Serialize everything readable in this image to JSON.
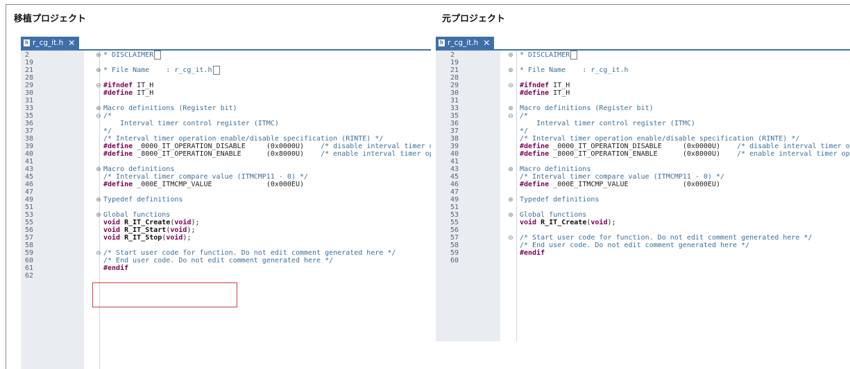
{
  "captions": {
    "left": "移植プロジェクト",
    "right": "元プロジェクト"
  },
  "tabs": {
    "left": "r_cg_it.h",
    "right": "r_cg_it.h"
  },
  "file_icon_glyph": "h",
  "close_glyph": "✕",
  "fold_glyphs": {
    "expand": "⊕",
    "collapse": "⊖"
  },
  "colors": {
    "tab": "#3e6fa8",
    "comment": "#3a6f9a",
    "keyword": "#7b0052",
    "highlight": "#d23a3a"
  },
  "left_lines": [
    {
      "ln": "2",
      "fold": "expand",
      "segs": [
        {
          "c": "cmt",
          "t": "* DISCLAIMER"
        },
        {
          "c": "box",
          "t": " "
        }
      ]
    },
    {
      "ln": "19"
    },
    {
      "ln": "21",
      "fold": "expand",
      "segs": [
        {
          "c": "cmt",
          "t": "* File Name    : r_cg_it.h"
        },
        {
          "c": "box",
          "t": " "
        }
      ]
    },
    {
      "ln": "28"
    },
    {
      "ln": "29",
      "fold": "collapse",
      "segs": [
        {
          "c": "kw",
          "t": "#ifndef"
        },
        {
          "c": "",
          "t": " IT_H"
        }
      ]
    },
    {
      "ln": "30",
      "segs": [
        {
          "c": "kw",
          "t": "#define"
        },
        {
          "c": "",
          "t": " IT_H"
        }
      ]
    },
    {
      "ln": "31"
    },
    {
      "ln": "33",
      "fold": "expand",
      "segs": [
        {
          "c": "cmt",
          "t": "Macro definitions (Register bit)"
        }
      ]
    },
    {
      "ln": "35",
      "fold": "collapse",
      "segs": [
        {
          "c": "cmt",
          "t": "/*"
        }
      ]
    },
    {
      "ln": "36",
      "segs": [
        {
          "c": "cmt",
          "t": "    Interval timer control register (ITMC)"
        }
      ]
    },
    {
      "ln": "37",
      "segs": [
        {
          "c": "cmt",
          "t": "*/"
        }
      ]
    },
    {
      "ln": "38",
      "segs": [
        {
          "c": "cmt",
          "t": "/* Interval timer operation enable/disable specification (RINTE) */"
        }
      ]
    },
    {
      "ln": "39",
      "segs": [
        {
          "c": "kw",
          "t": "#define"
        },
        {
          "c": "",
          "t": " _0000_IT_OPERATION_DISABLE     (0x0000U)    "
        },
        {
          "c": "cmt",
          "t": "/* disable interval timer operation */"
        }
      ]
    },
    {
      "ln": "40",
      "segs": [
        {
          "c": "kw",
          "t": "#define"
        },
        {
          "c": "",
          "t": " _8000_IT_OPERATION_ENABLE      (0x8000U)    "
        },
        {
          "c": "cmt",
          "t": "/* enable interval timer operation */"
        }
      ]
    },
    {
      "ln": "41"
    },
    {
      "ln": "43",
      "fold": "expand",
      "segs": [
        {
          "c": "cmt",
          "t": "Macro definitions"
        }
      ]
    },
    {
      "ln": "45",
      "segs": [
        {
          "c": "cmt",
          "t": "/* Interval timer compare value (ITMCMP11 - 0) */"
        }
      ]
    },
    {
      "ln": "46",
      "segs": [
        {
          "c": "kw",
          "t": "#define"
        },
        {
          "c": "",
          "t": " _000E_ITMCMP_VALUE             (0x000EU)"
        }
      ]
    },
    {
      "ln": "47"
    },
    {
      "ln": "49",
      "fold": "expand",
      "segs": [
        {
          "c": "cmt",
          "t": "Typedef definitions"
        }
      ]
    },
    {
      "ln": "51"
    },
    {
      "ln": "53",
      "fold": "expand",
      "segs": [
        {
          "c": "cmt",
          "t": "Global functions"
        }
      ]
    },
    {
      "ln": "55",
      "segs": [
        {
          "c": "kw",
          "t": "void"
        },
        {
          "c": "",
          "t": " "
        },
        {
          "c": "ident",
          "t": "R_IT_Create"
        },
        {
          "c": "",
          "t": "("
        },
        {
          "c": "kw",
          "t": "void"
        },
        {
          "c": "",
          "t": ");"
        }
      ]
    },
    {
      "ln": "56",
      "segs": [
        {
          "c": "kw",
          "t": "void"
        },
        {
          "c": "",
          "t": " "
        },
        {
          "c": "ident",
          "t": "R_IT_Start"
        },
        {
          "c": "",
          "t": "("
        },
        {
          "c": "kw",
          "t": "void"
        },
        {
          "c": "",
          "t": ");"
        }
      ]
    },
    {
      "ln": "57",
      "segs": [
        {
          "c": "kw",
          "t": "void"
        },
        {
          "c": "",
          "t": " "
        },
        {
          "c": "ident",
          "t": "R_IT_Stop"
        },
        {
          "c": "",
          "t": "("
        },
        {
          "c": "kw",
          "t": "void"
        },
        {
          "c": "",
          "t": ");"
        }
      ]
    },
    {
      "ln": "58"
    },
    {
      "ln": "59",
      "fold": "collapse",
      "segs": [
        {
          "c": "cmt",
          "t": "/* Start user code for function. Do not edit comment generated here */"
        }
      ]
    },
    {
      "ln": "60",
      "segs": [
        {
          "c": "cmt",
          "t": "/* End user code. Do not edit comment generated here */"
        }
      ]
    },
    {
      "ln": "61",
      "segs": [
        {
          "c": "kw",
          "t": "#endif"
        }
      ]
    },
    {
      "ln": "62"
    }
  ],
  "right_lines": [
    {
      "ln": "2",
      "fold": "expand",
      "segs": [
        {
          "c": "cmt",
          "t": "* DISCLAIMER"
        },
        {
          "c": "box",
          "t": " "
        }
      ]
    },
    {
      "ln": "19"
    },
    {
      "ln": "21",
      "fold": "expand",
      "segs": [
        {
          "c": "cmt",
          "t": "* File Name    : r_cg_it.h"
        }
      ]
    },
    {
      "ln": "28"
    },
    {
      "ln": "29",
      "fold": "collapse",
      "segs": [
        {
          "c": "kw",
          "t": "#ifndef"
        },
        {
          "c": "",
          "t": " IT_H"
        }
      ]
    },
    {
      "ln": "30",
      "segs": [
        {
          "c": "kw",
          "t": "#define"
        },
        {
          "c": "",
          "t": " IT_H"
        }
      ]
    },
    {
      "ln": "31"
    },
    {
      "ln": "33",
      "fold": "expand",
      "segs": [
        {
          "c": "cmt",
          "t": "Macro definitions (Register bit)"
        }
      ]
    },
    {
      "ln": "35",
      "fold": "collapse",
      "segs": [
        {
          "c": "cmt",
          "t": "/*"
        }
      ]
    },
    {
      "ln": "36",
      "segs": [
        {
          "c": "cmt",
          "t": "    Interval timer control register (ITMC)"
        }
      ]
    },
    {
      "ln": "37",
      "segs": [
        {
          "c": "cmt",
          "t": "*/"
        }
      ]
    },
    {
      "ln": "38",
      "segs": [
        {
          "c": "cmt",
          "t": "/* Interval timer operation enable/disable specification (RINTE) */"
        }
      ]
    },
    {
      "ln": "39",
      "segs": [
        {
          "c": "kw",
          "t": "#define"
        },
        {
          "c": "",
          "t": " _0000_IT_OPERATION_DISABLE     (0x0000U)    "
        },
        {
          "c": "cmt",
          "t": "/* disable interval timer operation */"
        }
      ]
    },
    {
      "ln": "40",
      "segs": [
        {
          "c": "kw",
          "t": "#define"
        },
        {
          "c": "",
          "t": " _8000_IT_OPERATION_ENABLE      (0x8000U)    "
        },
        {
          "c": "cmt",
          "t": "/* enable interval timer operation */"
        }
      ]
    },
    {
      "ln": "41"
    },
    {
      "ln": "43",
      "fold": "expand",
      "segs": [
        {
          "c": "cmt",
          "t": "Macro definitions"
        }
      ]
    },
    {
      "ln": "45",
      "segs": [
        {
          "c": "cmt",
          "t": "/* Interval timer compare value (ITMCMP11 - 0) */"
        }
      ]
    },
    {
      "ln": "46",
      "segs": [
        {
          "c": "kw",
          "t": "#define"
        },
        {
          "c": "",
          "t": " _000E_ITMCMP_VALUE             (0x000EU)"
        }
      ]
    },
    {
      "ln": "47"
    },
    {
      "ln": "49",
      "fold": "expand",
      "segs": [
        {
          "c": "cmt",
          "t": "Typedef definitions"
        }
      ]
    },
    {
      "ln": "51"
    },
    {
      "ln": "53",
      "fold": "expand",
      "segs": [
        {
          "c": "cmt",
          "t": "Global functions"
        }
      ]
    },
    {
      "ln": "55",
      "segs": [
        {
          "c": "kw",
          "t": "void"
        },
        {
          "c": "",
          "t": " "
        },
        {
          "c": "ident",
          "t": "R_IT_Create"
        },
        {
          "c": "",
          "t": "("
        },
        {
          "c": "kw",
          "t": "void"
        },
        {
          "c": "",
          "t": ");"
        }
      ]
    },
    {
      "ln": "56"
    },
    {
      "ln": "57",
      "fold": "collapse",
      "segs": [
        {
          "c": "cmt",
          "t": "/* Start user code for function. Do not edit comment generated here */"
        }
      ]
    },
    {
      "ln": "58",
      "segs": [
        {
          "c": "cmt",
          "t": "/* End user code. Do not edit comment generated here */"
        }
      ]
    },
    {
      "ln": "59",
      "segs": [
        {
          "c": "kw",
          "t": "#endif"
        }
      ]
    },
    {
      "ln": "60"
    }
  ]
}
